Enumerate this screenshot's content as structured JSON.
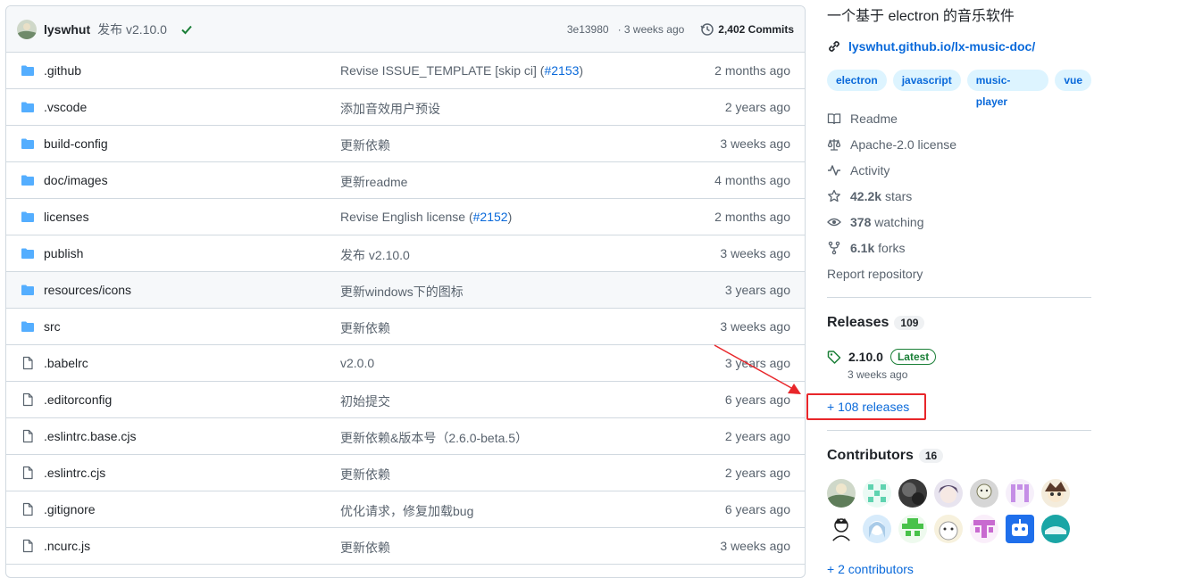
{
  "commit": {
    "author": "lyswhut",
    "message": "发布 v2.10.0",
    "hash": "3e13980",
    "time": "· 3 weeks ago",
    "commits_label": "2,402 Commits"
  },
  "files": [
    {
      "icon": "folder-icon",
      "name": ".github",
      "msg": "Revise ISSUE_TEMPLATE [skip ci] (",
      "pr": "#2153",
      "after": ")",
      "date": "2 months ago"
    },
    {
      "icon": "folder-icon",
      "name": ".vscode",
      "msg": "添加音效用户预设",
      "pr": "",
      "after": "",
      "date": "2 years ago"
    },
    {
      "icon": "folder-icon",
      "name": "build-config",
      "msg": "更新依赖",
      "pr": "",
      "after": "",
      "date": "3 weeks ago"
    },
    {
      "icon": "folder-icon",
      "name": "doc/images",
      "msg": "更新readme",
      "pr": "",
      "after": "",
      "date": "4 months ago"
    },
    {
      "icon": "folder-icon",
      "name": "licenses",
      "msg": "Revise English license (",
      "pr": "#2152",
      "after": ")",
      "date": "2 months ago"
    },
    {
      "icon": "folder-icon",
      "name": "publish",
      "msg": "发布 v2.10.0",
      "pr": "",
      "after": "",
      "date": "3 weeks ago"
    },
    {
      "icon": "folder-icon",
      "name": "resources/icons",
      "msg": "更新windows下的图标",
      "pr": "",
      "after": "",
      "date": "3 years ago"
    },
    {
      "icon": "folder-icon",
      "name": "src",
      "msg": "更新依赖",
      "pr": "",
      "after": "",
      "date": "3 weeks ago"
    },
    {
      "icon": "file-icon",
      "name": ".babelrc",
      "msg": "v2.0.0",
      "pr": "",
      "after": "",
      "date": "3 years ago"
    },
    {
      "icon": "file-icon",
      "name": ".editorconfig",
      "msg": "初始提交",
      "pr": "",
      "after": "",
      "date": "6 years ago"
    },
    {
      "icon": "file-icon",
      "name": ".eslintrc.base.cjs",
      "msg": "更新依赖&版本号（2.6.0-beta.5）",
      "pr": "",
      "after": "",
      "date": "2 years ago"
    },
    {
      "icon": "file-icon",
      "name": ".eslintrc.cjs",
      "msg": "更新依赖",
      "pr": "",
      "after": "",
      "date": "2 years ago"
    },
    {
      "icon": "file-icon",
      "name": ".gitignore",
      "msg": "优化请求，修复加载bug",
      "pr": "",
      "after": "",
      "date": "6 years ago"
    },
    {
      "icon": "file-icon",
      "name": ".ncurc.js",
      "msg": "更新依赖",
      "pr": "",
      "after": "",
      "date": "3 weeks ago"
    }
  ],
  "about": {
    "description": "一个基于 electron 的音乐软件",
    "homepage": "lyswhut.github.io/lx-music-doc/",
    "topics": [
      "electron",
      "javascript",
      "music-player",
      "vue"
    ],
    "readme": "Readme",
    "license": "Apache-2.0 license",
    "activity": "Activity",
    "stars_count": "42.2k",
    "stars_label": "stars",
    "watching_count": "378",
    "watching_label": "watching",
    "forks_count": "6.1k",
    "forks_label": "forks",
    "report": "Report repository"
  },
  "releases": {
    "title": "Releases",
    "count": "109",
    "latest_version": "2.10.0",
    "latest_badge": "Latest",
    "latest_time": "3 weeks ago",
    "more": "+ 108 releases"
  },
  "contributors": {
    "title": "Contributors",
    "count": "16",
    "cut_text": "+ 2 contributors"
  },
  "colors": {
    "accent": "#0969da",
    "annotation": "#e8262a",
    "folder": "#54aeff"
  }
}
